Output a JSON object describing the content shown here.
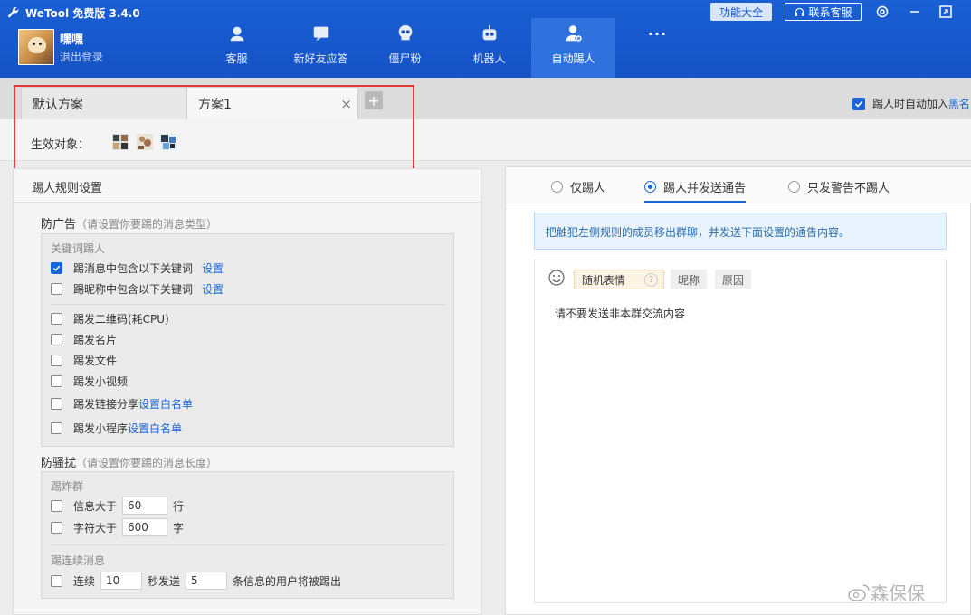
{
  "app": {
    "title": "WeTool 免费版 3.4.0"
  },
  "header": {
    "features_btn": "功能大全",
    "service_btn": "联系客服"
  },
  "profile": {
    "name": "嘿嘿",
    "logout": "退出登录"
  },
  "nav": [
    {
      "label": "客服",
      "icon": "headset-icon"
    },
    {
      "label": "新好友应答",
      "icon": "chat-bubble-icon"
    },
    {
      "label": "僵尸粉",
      "icon": "skull-icon"
    },
    {
      "label": "机器人",
      "icon": "robot-icon"
    },
    {
      "label": "自动踢人",
      "icon": "user-kick-icon",
      "active": true
    }
  ],
  "nav_more": "···",
  "tabs": {
    "items": [
      "默认方案",
      "方案1"
    ],
    "active": 1,
    "add": "+"
  },
  "auto_blacklist": {
    "label": "踢人时自动加入",
    "link": "黑名"
  },
  "effect": {
    "label": "生效对象："
  },
  "rules": {
    "title": "踢人规则设置",
    "anti_ad": {
      "title": "防广告",
      "hint": "（请设置你要踢的消息类型）",
      "keyword_group": "关键词踢人",
      "kw_msg": "踢消息中包含以下关键词",
      "kw_nick": "踢昵称中包含以下关键词",
      "set": "设置",
      "qr": "踢发二维码(耗CPU)",
      "card": "踢发名片",
      "file": "踢发文件",
      "video": "踢发小视频",
      "link_share": "踢发链接分享",
      "mini_prog": "踢发小程序",
      "whitelist": "设置白名单"
    },
    "anti_spam": {
      "title": "防骚扰",
      "hint": "（请设置你要踢的消息长度）",
      "bomb_group": "踢炸群",
      "msg_over": "信息大于",
      "msg_value": "60",
      "msg_unit": "行",
      "char_over": "字符大于",
      "char_value": "600",
      "char_unit": "字",
      "cont_group": "踢连续消息",
      "cont_label": "连续",
      "cont_sec": "10",
      "cont_mid": "秒发送",
      "cont_count": "5",
      "cont_tail": "条信息的用户将被踢出"
    }
  },
  "action": {
    "options": [
      "仅踢人",
      "踢人并发送通告",
      "只发警告不踢人"
    ],
    "selected": 1,
    "notice": "把触犯左侧规则的成员移出群聊，并发送下面设置的通告内容。",
    "chips": {
      "random_emoji": "随机表情",
      "help": "?",
      "nickname": "昵称",
      "reason": "原因"
    },
    "content": "请不要发送非本群交流内容"
  },
  "watermark": "森保保",
  "colors": {
    "primary": "#1553c6",
    "accent": "#1a66d8",
    "highlight": "#e33a3a"
  }
}
